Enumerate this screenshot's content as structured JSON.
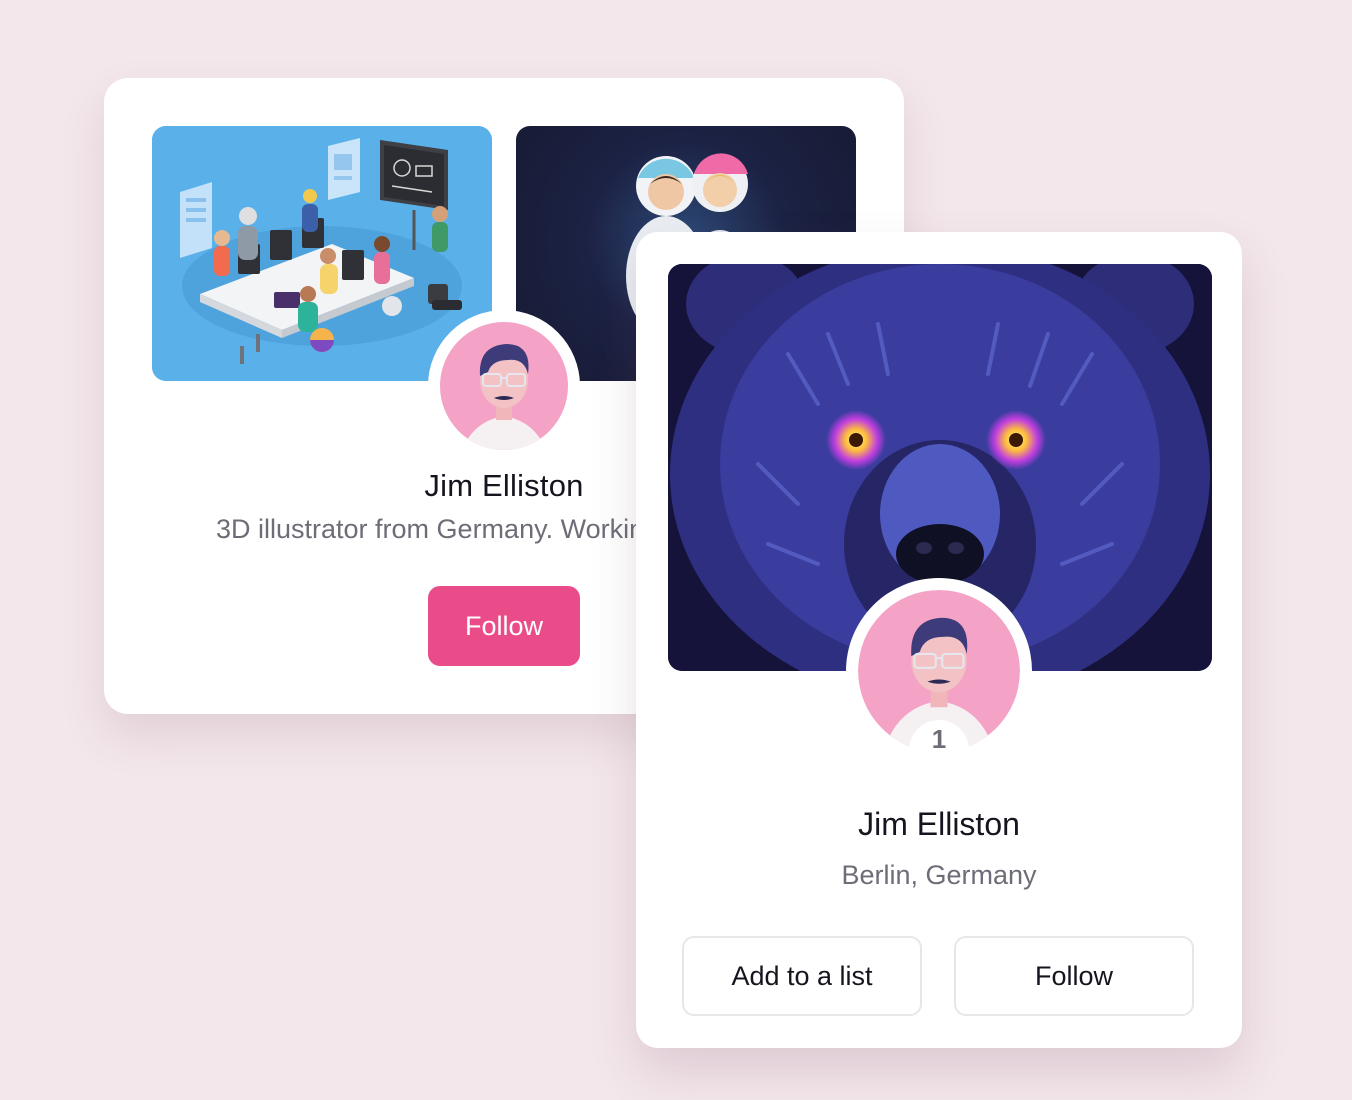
{
  "back_card": {
    "name": "Jim Elliston",
    "bio": "3D illustrator from Germany. Working remotely with teams worldwide",
    "follow_label": "Follow",
    "shots": [
      {
        "icon": "office-teamwork-illustration"
      },
      {
        "icon": "astronauts-illustration"
      }
    ]
  },
  "front_card": {
    "hero_icon": "bear-illustration",
    "avatar_icon": "avatar-man-with-glasses",
    "badge_count": "1",
    "name": "Jim Elliston",
    "location": "Berlin, Germany",
    "add_to_list_label": "Add to a list",
    "follow_label": "Follow"
  },
  "colors": {
    "background": "#f3e7eb",
    "accent_pink": "#ea4c89",
    "text_primary": "#15151f",
    "text_secondary": "#6d6d78"
  }
}
